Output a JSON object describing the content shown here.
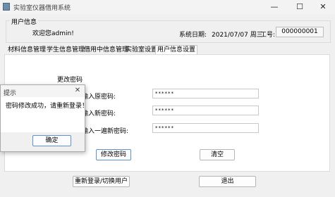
{
  "window": {
    "title": "实验室仪器借用系统",
    "minimize_glyph": "—",
    "maximize_glyph": "☐",
    "close_glyph": "✕"
  },
  "user_info": {
    "group_title": "用户信息",
    "welcome": "欢迎您admin!",
    "date_label": "系统日期:",
    "date_value": "2021/07/07 周三",
    "jobno_label": "工号:",
    "jobno_value": "000000001"
  },
  "tabs": [
    {
      "label": "材料信息管理"
    },
    {
      "label": "学生信息管理"
    },
    {
      "label": "借用中信息管理"
    },
    {
      "label": "实验室设置"
    },
    {
      "label": "用户信息设置",
      "active": true
    }
  ],
  "change_password": {
    "section_title": "更改密码",
    "fields": [
      {
        "label": "请输入原密码:",
        "value": "******"
      },
      {
        "label": "请输入新密码:",
        "value": "******"
      },
      {
        "label": "请输入一遍新密码:",
        "value": "******"
      }
    ],
    "submit_label": "修改密码",
    "clear_label": "清空"
  },
  "footer": {
    "relogin_label": "重新登录/切换用户",
    "exit_label": "退出"
  },
  "dialog": {
    "title": "提示",
    "message": "密码修改成功，请重新登录！",
    "ok_label": "确定",
    "close_glyph": "✕"
  }
}
